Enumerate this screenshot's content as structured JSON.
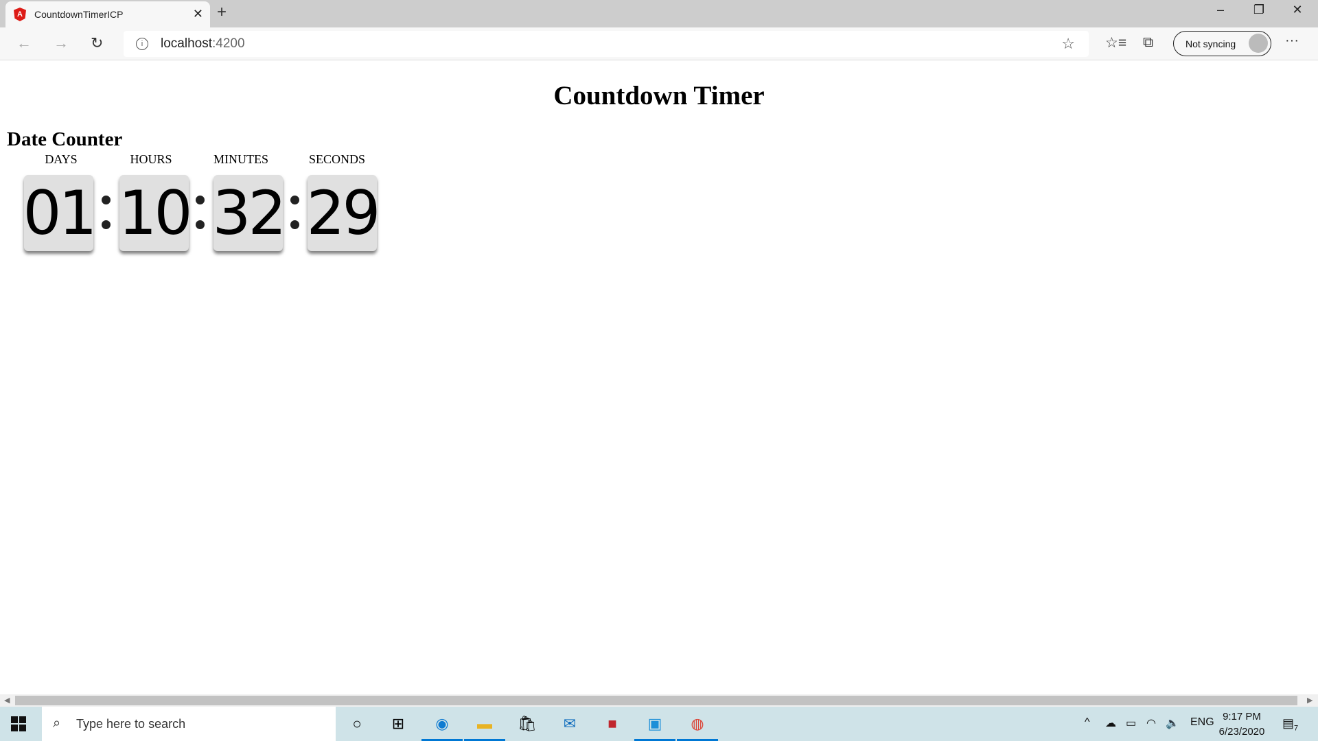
{
  "browser": {
    "tab_title": "CountdownTimerICP",
    "url_host": "localhost",
    "url_port": ":4200",
    "sync_label": "Not syncing"
  },
  "page": {
    "title": "Countdown Timer",
    "subtitle": "Date Counter",
    "units": [
      {
        "label": "DAYS",
        "value": "01"
      },
      {
        "label": "HOURS",
        "value": "10"
      },
      {
        "label": "MINUTES",
        "value": "32"
      },
      {
        "label": "SECONDS",
        "value": "29"
      }
    ]
  },
  "taskbar": {
    "search_placeholder": "Type here to search",
    "language": "ENG",
    "time": "9:17 PM",
    "date": "6/23/2020",
    "notification_count": "7"
  }
}
